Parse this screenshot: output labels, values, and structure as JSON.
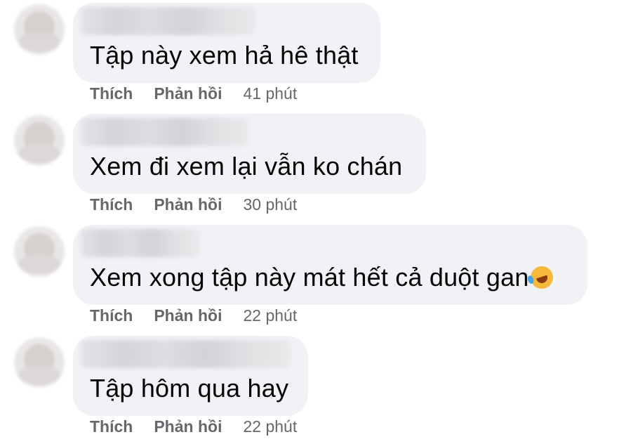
{
  "comments": [
    {
      "text": "Tập này xem hả hê thật",
      "like": "Thích",
      "reply": "Phản hồi",
      "time": "41 phút",
      "emoji": ""
    },
    {
      "text": "Xem đi xem lại vẫn ko chán",
      "like": "Thích",
      "reply": "Phản hồi",
      "time": "30 phút",
      "emoji": ""
    },
    {
      "text": "Xem xong tập này mát hết cả duột gan",
      "like": "Thích",
      "reply": "Phản hồi",
      "time": "22 phút",
      "emoji": "rolling-on-floor-laughing-emoji"
    },
    {
      "text": "Tập hôm qua hay",
      "like": "Thích",
      "reply": "Phản hồi",
      "time": "22 phút",
      "emoji": ""
    }
  ],
  "colors": {
    "bubble": "#f0f2f5",
    "text": "#050505",
    "meta": "#65676b"
  }
}
